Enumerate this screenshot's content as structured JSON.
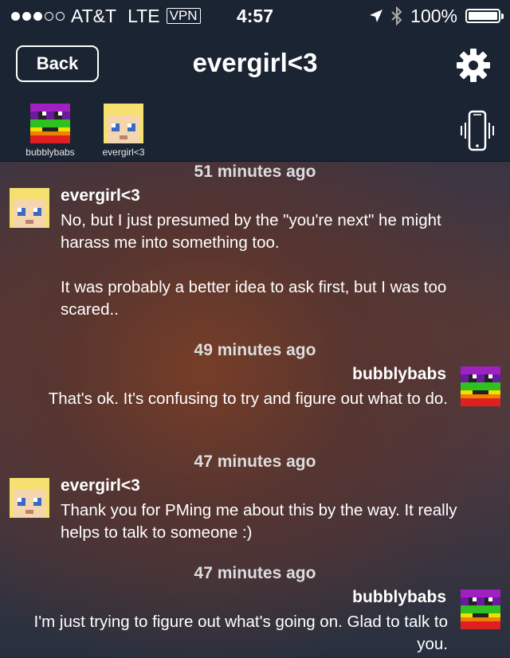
{
  "status_bar": {
    "carrier": "AT&T",
    "network": "LTE",
    "vpn": "VPN",
    "time": "4:57",
    "battery": "100%",
    "signal_bars_filled": 3,
    "signal_bars_total": 5
  },
  "nav": {
    "back_label": "Back",
    "title": "evergirl<3"
  },
  "participants": [
    {
      "name": "bubblybabs",
      "avatar": "rainbow-pixel-avatar"
    },
    {
      "name": "evergirl<3",
      "avatar": "blonde-pixel-avatar"
    }
  ],
  "messages": [
    {
      "timestamp": "51 minutes ago",
      "sender": "evergirl<3",
      "side": "left",
      "paragraphs": [
        "No, but I just presumed by the \"you're next\" he might harass me into something too.",
        "It was probably a better idea to ask first, but I was too scared.."
      ]
    },
    {
      "timestamp": "49 minutes ago",
      "sender": "bubblybabs",
      "side": "right",
      "paragraphs": [
        "That's ok.  It's confusing to try and figure out what to do."
      ]
    },
    {
      "timestamp": "47 minutes ago",
      "sender": "evergirl<3",
      "side": "left",
      "paragraphs": [
        "Thank you for PMing me about this by the way. It really helps to talk to someone :)"
      ]
    },
    {
      "timestamp": "47 minutes ago",
      "sender": "bubblybabs",
      "side": "right",
      "paragraphs": [
        "I'm just trying to figure out what's going on.  Glad to talk to you."
      ]
    }
  ]
}
